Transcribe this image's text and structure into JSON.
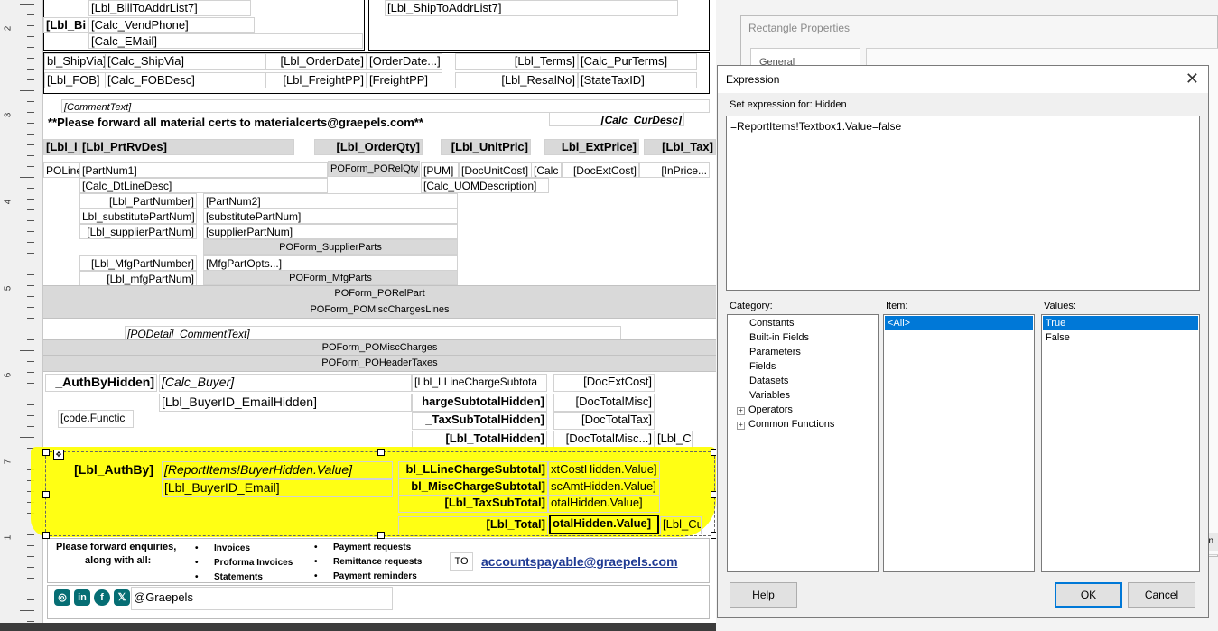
{
  "ruler": {
    "labels": [
      "2",
      "3",
      "4",
      "5",
      "6",
      "7",
      "1"
    ]
  },
  "designer": {
    "header": {
      "bill_to_addr7": "[Lbl_BillToAddrList7]",
      "lbl_bi": "[Lbl_Bi",
      "vend_phone": "[Calc_VendPhone]",
      "email": "[Calc_EMail]",
      "ship_to_addr7": "[Lbl_ShipToAddrList7]"
    },
    "info_row1": [
      "bl_ShipVia]",
      "[Calc_ShipVia]",
      "[Lbl_OrderDate]",
      "[OrderDate...]",
      "[Lbl_Terms]",
      "[Calc_PurTerms]"
    ],
    "info_row2": [
      "[Lbl_FOB]",
      "[Calc_FOBDesc]",
      "[Lbl_FreightPP]",
      "[FreightPP]",
      "[Lbl_ResalNo]",
      "[StateTaxID]"
    ],
    "comment_text": "[CommentText]",
    "forward_certs": "**Please forward all material certs to materialcerts@graepels.com**",
    "cur_desc": "[Calc_CurDesc]",
    "col_headers": [
      "[Lbl_l",
      "[Lbl_PrtRvDes]",
      "[Lbl_OrderQty]",
      "[Lbl_UnitPric]",
      "Lbl_ExtPrice]",
      "[Lbl_Tax]"
    ],
    "line_row": [
      "POLine",
      "[PartNum1]",
      "POForm_PORelQty",
      "[PUM]",
      "[DocUnitCost]",
      "[Calc",
      "[DocExtCost]",
      "[InPrice..."
    ],
    "dtline_desc": "[Calc_DtLineDesc]",
    "uom_desc": "[Calc_UOMDescription]",
    "part_rows": [
      {
        "label": "[Lbl_PartNumber]",
        "value": "[PartNum2]"
      },
      {
        "label": "Lbl_substitutePartNum]",
        "value": "[substitutePartNum]"
      },
      {
        "label": "[Lbl_supplierPartNum]",
        "value": "[supplierPartNum]"
      }
    ],
    "supplier_parts": "POForm_SupplierParts",
    "mfg_part_number": "[Lbl_MfgPartNumber]",
    "mfg_part_opts": "[MfgPartOpts...]",
    "mfg_part_num": "[Lbl_mfgPartNum]",
    "mfg_parts": "POForm_MfgParts",
    "rel_part": "POForm_PORelPart",
    "misc_charges_lines": "POForm_POMiscChargesLines",
    "podetail_comment": "[PODetail_CommentText]",
    "misc_charges": "POForm_POMiscCharges",
    "header_taxes": "POForm_POHeaderTaxes",
    "totals_hidden": {
      "auth_by_hidden": "_AuthByHidden]",
      "calc_buyer": "[Calc_Buyer]",
      "buyer_email_hidden": "[Lbl_BuyerID_EmailHidden]",
      "code_functic": "[code.Functic",
      "lline_charge_subtota": "[Lbl_LLineChargeSubtota",
      "charge_subtotal_hidden": "hargeSubtotalHidden]",
      "tax_subtotal_hidden": "_TaxSubTotalHidden]",
      "total_hidden": "[Lbl_TotalHidden]",
      "doc_ext_cost": "[DocExtCost]",
      "doc_total_misc": "[DocTotalMisc]",
      "doc_total_tax": "[DocTotalTax]",
      "doc_total_misc2": "[DocTotalMisc...]",
      "lbl_c": "[Lbl_C"
    },
    "totals_visible": {
      "auth_by": "[Lbl_AuthBy]",
      "buyer_hidden_value": "[ReportItems!BuyerHidden.Value]",
      "buyer_email": "[Lbl_BuyerID_Email]",
      "lline_charge_subtotal": "bl_LLineChargeSubtotal]",
      "misc_charge_subtotal": "bl_MiscChargeSubtotal]",
      "tax_subtotal": "[Lbl_TaxSubTotal]",
      "total": "[Lbl_Total]",
      "cost_hidden": "xtCostHidden.Value]",
      "amt_hidden": "scAmtHidden.Value]",
      "total_hidden_value": "otalHidden.Value]",
      "total_hidden_bold": "otalHidden.Value]",
      "lbl_cu": "[Lbl_Cu"
    },
    "footer": {
      "enquiries_line1": "Please forward enquiries,",
      "enquiries_line2": "along with all:",
      "bullets_left": [
        "Invoices",
        "Proforma Invoices",
        "Statements"
      ],
      "bullets_right": [
        "Payment requests",
        "Remittance requests",
        "Payment reminders"
      ],
      "to": "TO",
      "email": "accountspayable@graepels.com",
      "handle": "@Graepels",
      "social_icons": [
        "instagram-icon",
        "linkedin-icon",
        "facebook-icon",
        "x-icon"
      ]
    }
  },
  "rect_dialog": {
    "title": "Rectangle Properties",
    "tab_general": "General"
  },
  "expr_dialog": {
    "title": "Expression",
    "set_expression_for": "Set expression for: Hidden",
    "expression": "=ReportItems!Textbox1.Value=false",
    "category_label": "Category:",
    "item_label": "Item:",
    "values_label": "Values:",
    "categories": [
      "Constants",
      "Built-in Fields",
      "Parameters",
      "Fields",
      "Datasets",
      "Variables",
      "Operators",
      "Common Functions"
    ],
    "items": [
      "<All>"
    ],
    "values": [
      "True",
      "False"
    ],
    "help": "Help",
    "ok": "OK",
    "cancel": "Cancel"
  },
  "colors": {
    "highlight": "#ffff00",
    "selection": "#0078d7",
    "link": "#1f3a93"
  }
}
